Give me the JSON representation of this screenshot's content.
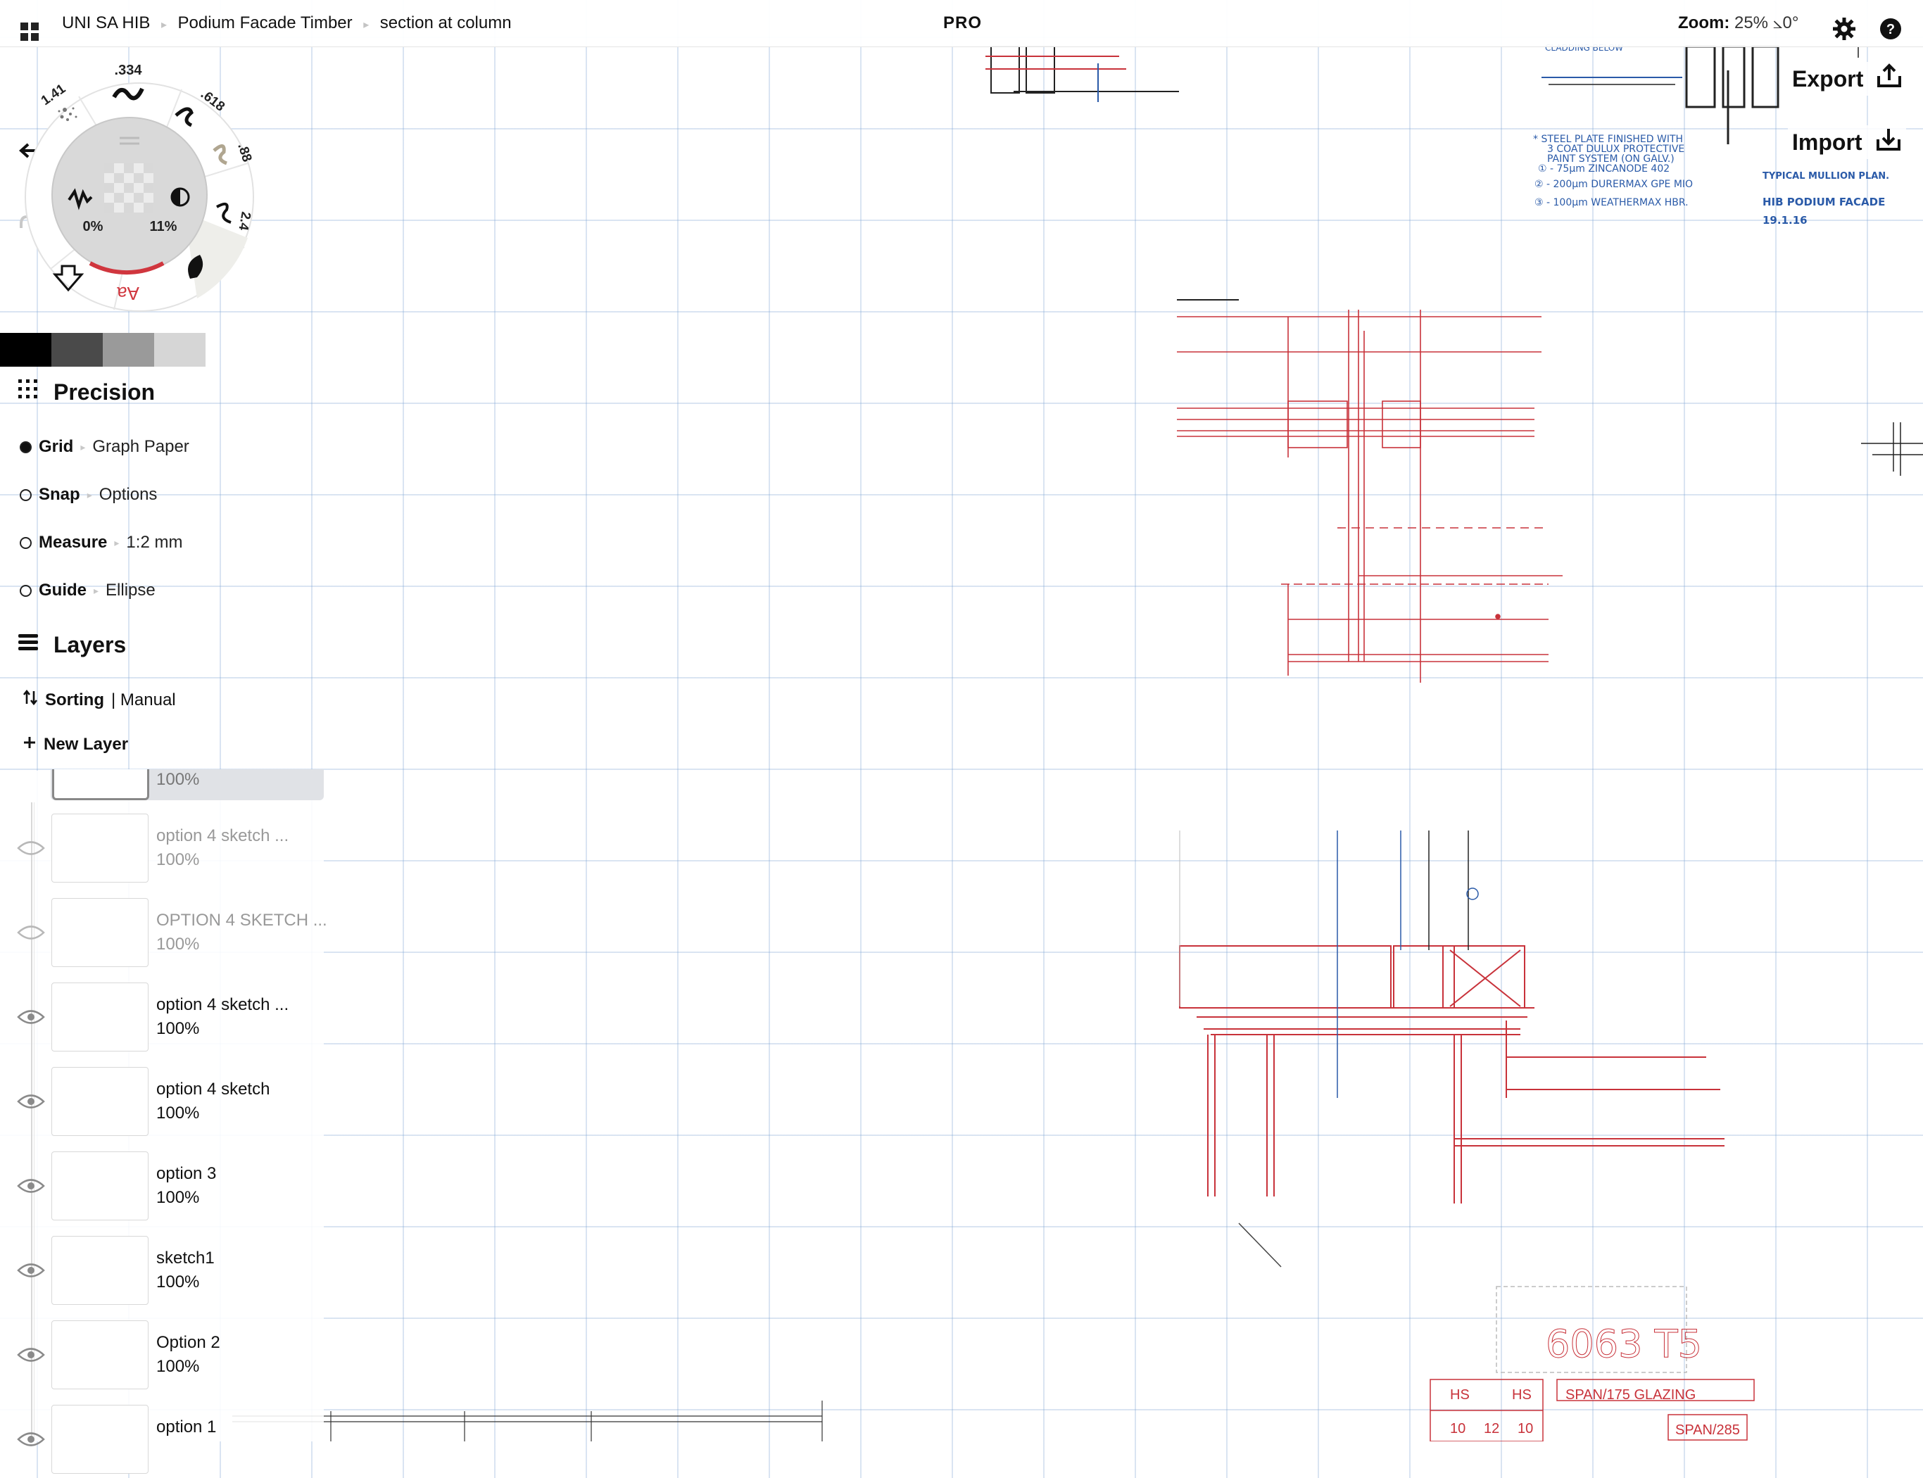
{
  "topbar": {
    "breadcrumb": [
      "UNI SA HIB",
      "Podium Facade Timber",
      "section at column"
    ],
    "pro_label": "PRO",
    "zoom_label": "Zoom:",
    "zoom_value": "25%",
    "rotation_value": "⦣0°"
  },
  "actions": {
    "export_label": "Export",
    "import_label": "Import"
  },
  "brush_wheel": {
    "slots": [
      ".334",
      ".618",
      ".88",
      "2.4",
      "1.41"
    ],
    "opacity": "0%",
    "smoothing": "11%",
    "text_tool_label": "Aa"
  },
  "swatches": [
    "#000000",
    "#4a4a4a",
    "#9a9a9a",
    "#d6d6d6"
  ],
  "precision": {
    "title": "Precision",
    "rows": [
      {
        "name": "Grid",
        "value": "Graph Paper",
        "on": true
      },
      {
        "name": "Snap",
        "value": "Options",
        "on": false
      },
      {
        "name": "Measure",
        "value": "1:2 mm",
        "on": false
      },
      {
        "name": "Guide",
        "value": "Ellipse",
        "on": false
      }
    ]
  },
  "layers": {
    "title": "Layers",
    "sorting_label": "Sorting",
    "sorting_value": "| Manual",
    "new_layer_label": "New Layer",
    "selected_opacity": "100%",
    "items": [
      {
        "name": "option 4 sketch ...",
        "opacity": "100%",
        "visible": false
      },
      {
        "name": "OPTION 4 SKETCH ...",
        "opacity": "100%",
        "visible": false
      },
      {
        "name": "option 4 sketch ...",
        "opacity": "100%",
        "visible": true
      },
      {
        "name": "option 4 sketch",
        "opacity": "100%",
        "visible": true
      },
      {
        "name": "option 3",
        "opacity": "100%",
        "visible": true
      },
      {
        "name": "sketch1",
        "opacity": "100%",
        "visible": true
      },
      {
        "name": "Option 2",
        "opacity": "100%",
        "visible": true
      },
      {
        "name": "option 1",
        "opacity": "",
        "visible": true
      }
    ]
  },
  "canvas_notes": {
    "cladding": "CLADDING BELOW",
    "spec": [
      "* STEEL PLATE FINISHED WITH",
      "3 COAT DULUX PROTECTIVE",
      "PAINT SYSTEM (ON GALV.)",
      "① - 75μm ZINCANODE 402",
      "② - 200μm DURERMAX GPE MIO",
      "③ - 100μm WEATHERMAX HBR."
    ],
    "title_block": [
      "TYPICAL MULLION PLAN.",
      "HIB PODIUM FACADE",
      "19.1.16"
    ],
    "tag_main": "6063 T5",
    "tag_row1": [
      "HS",
      "HS",
      "SPAN/175 GLAZING"
    ],
    "tag_row2": [
      "10",
      "12",
      "10",
      "SPAN/285"
    ]
  },
  "colors": {
    "ink": "#111111",
    "red_ink": "#c8323a",
    "blue_ink": "#2a5aa8",
    "grid": "#a8c4e4"
  }
}
